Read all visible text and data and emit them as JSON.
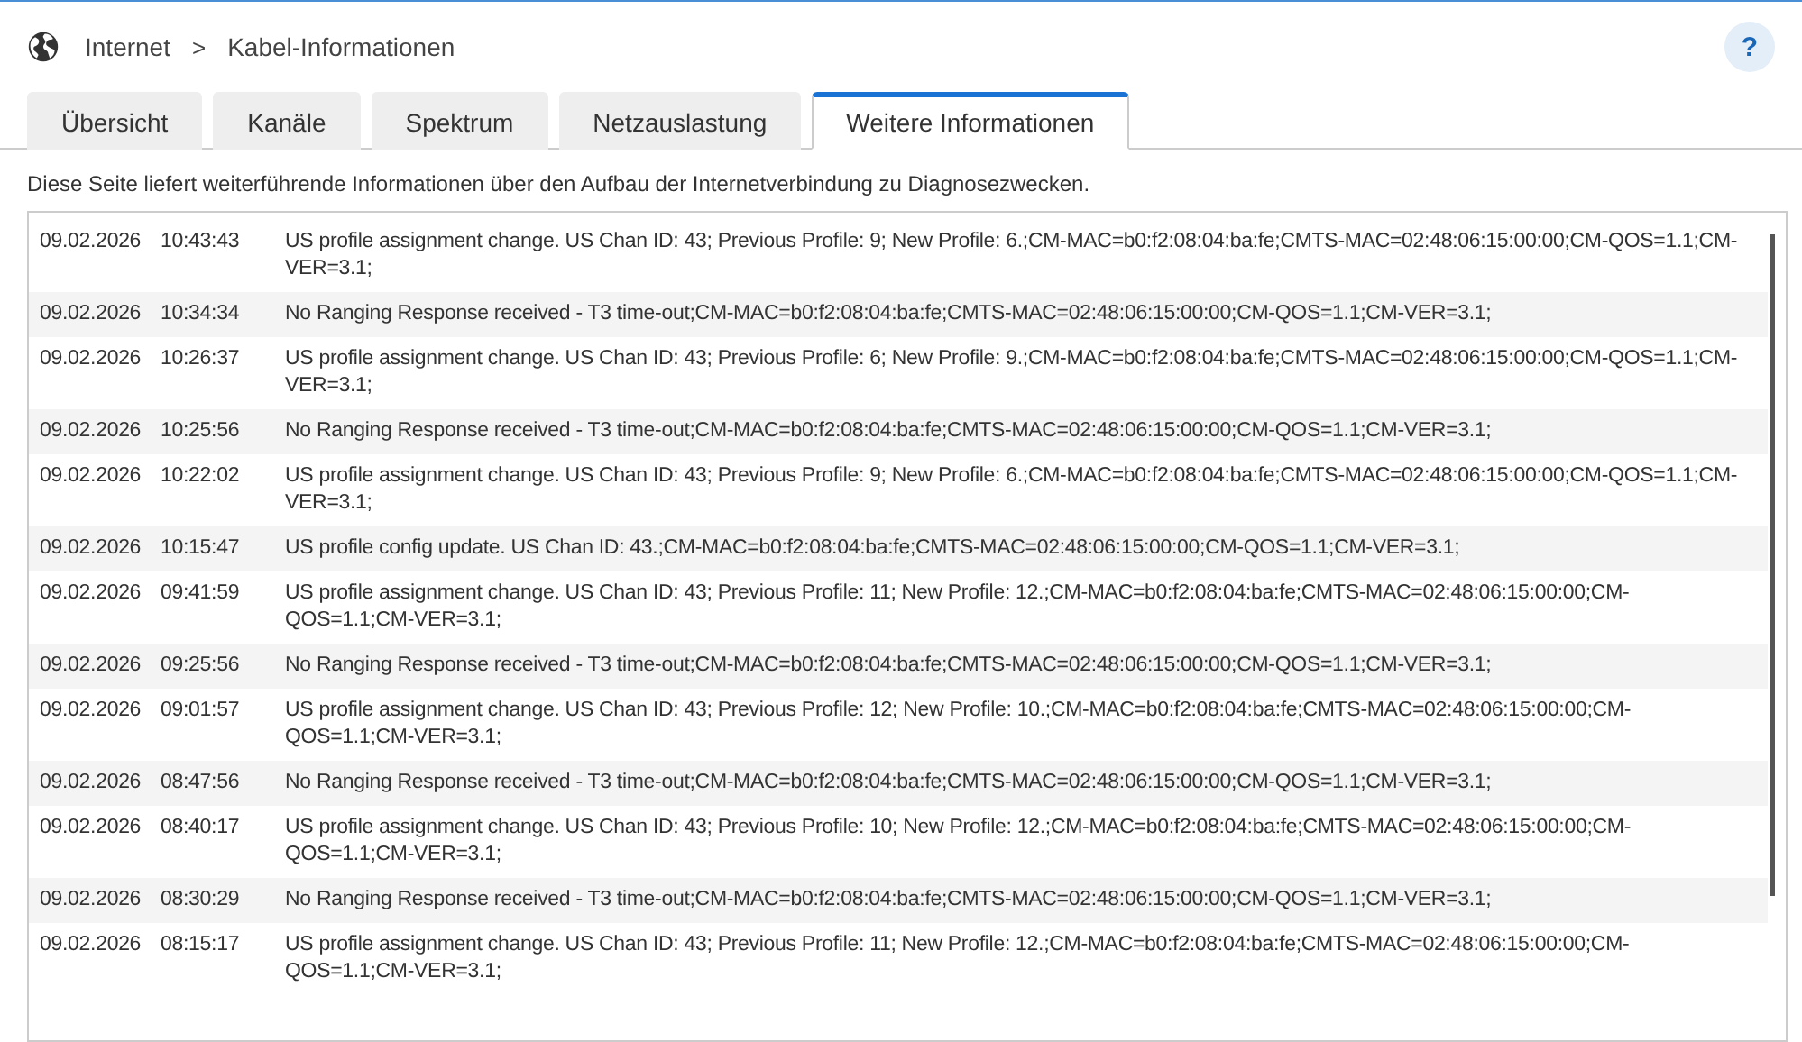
{
  "breadcrumb": {
    "items": [
      "Internet",
      "Kabel-Informationen"
    ],
    "separator": ">"
  },
  "help_button": {
    "label": "?"
  },
  "tabs": [
    {
      "label": "Übersicht",
      "selected": false
    },
    {
      "label": "Kanäle",
      "selected": false
    },
    {
      "label": "Spektrum",
      "selected": false
    },
    {
      "label": "Netzauslastung",
      "selected": false
    },
    {
      "label": "Weitere Informationen",
      "selected": true
    }
  ],
  "description": "Diese Seite liefert weiterführende Informationen über den Aufbau der Internetverbindung zu Diagnosezwecken.",
  "log": {
    "rows": [
      {
        "date": "09.02.2026",
        "time": "10:43:43",
        "message": "US profile assignment change. US Chan ID: 43; Previous Profile: 9; New Profile: 6.;CM-MAC=b0:f2:08:04:ba:fe;CMTS-MAC=02:48:06:15:00:00;CM-QOS=1.1;CM-VER=3.1;"
      },
      {
        "date": "09.02.2026",
        "time": "10:34:34",
        "message": "No Ranging Response received - T3 time-out;CM-MAC=b0:f2:08:04:ba:fe;CMTS-MAC=02:48:06:15:00:00;CM-QOS=1.1;CM-VER=3.1;"
      },
      {
        "date": "09.02.2026",
        "time": "10:26:37",
        "message": "US profile assignment change. US Chan ID: 43; Previous Profile: 6; New Profile: 9.;CM-MAC=b0:f2:08:04:ba:fe;CMTS-MAC=02:48:06:15:00:00;CM-QOS=1.1;CM-VER=3.1;"
      },
      {
        "date": "09.02.2026",
        "time": "10:25:56",
        "message": "No Ranging Response received - T3 time-out;CM-MAC=b0:f2:08:04:ba:fe;CMTS-MAC=02:48:06:15:00:00;CM-QOS=1.1;CM-VER=3.1;"
      },
      {
        "date": "09.02.2026",
        "time": "10:22:02",
        "message": "US profile assignment change. US Chan ID: 43; Previous Profile: 9; New Profile: 6.;CM-MAC=b0:f2:08:04:ba:fe;CMTS-MAC=02:48:06:15:00:00;CM-QOS=1.1;CM-VER=3.1;"
      },
      {
        "date": "09.02.2026",
        "time": "10:15:47",
        "message": "US profile config update. US Chan ID: 43.;CM-MAC=b0:f2:08:04:ba:fe;CMTS-MAC=02:48:06:15:00:00;CM-QOS=1.1;CM-VER=3.1;"
      },
      {
        "date": "09.02.2026",
        "time": "09:41:59",
        "message": "US profile assignment change. US Chan ID: 43; Previous Profile: 11; New Profile: 12.;CM-MAC=b0:f2:08:04:ba:fe;CMTS-MAC=02:48:06:15:00:00;CM-QOS=1.1;CM-VER=3.1;"
      },
      {
        "date": "09.02.2026",
        "time": "09:25:56",
        "message": "No Ranging Response received - T3 time-out;CM-MAC=b0:f2:08:04:ba:fe;CMTS-MAC=02:48:06:15:00:00;CM-QOS=1.1;CM-VER=3.1;"
      },
      {
        "date": "09.02.2026",
        "time": "09:01:57",
        "message": "US profile assignment change. US Chan ID: 43; Previous Profile: 12; New Profile: 10.;CM-MAC=b0:f2:08:04:ba:fe;CMTS-MAC=02:48:06:15:00:00;CM-QOS=1.1;CM-VER=3.1;"
      },
      {
        "date": "09.02.2026",
        "time": "08:47:56",
        "message": "No Ranging Response received - T3 time-out;CM-MAC=b0:f2:08:04:ba:fe;CMTS-MAC=02:48:06:15:00:00;CM-QOS=1.1;CM-VER=3.1;"
      },
      {
        "date": "09.02.2026",
        "time": "08:40:17",
        "message": "US profile assignment change. US Chan ID: 43; Previous Profile: 10; New Profile: 12.;CM-MAC=b0:f2:08:04:ba:fe;CMTS-MAC=02:48:06:15:00:00;CM-QOS=1.1;CM-VER=3.1;"
      },
      {
        "date": "09.02.2026",
        "time": "08:30:29",
        "message": "No Ranging Response received - T3 time-out;CM-MAC=b0:f2:08:04:ba:fe;CMTS-MAC=02:48:06:15:00:00;CM-QOS=1.1;CM-VER=3.1;"
      },
      {
        "date": "09.02.2026",
        "time": "08:15:17",
        "message": "US profile assignment change. US Chan ID: 43; Previous Profile: 11; New Profile: 12.;CM-MAC=b0:f2:08:04:ba:fe;CMTS-MAC=02:48:06:15:00:00;CM-QOS=1.1;CM-VER=3.1;"
      }
    ]
  }
}
